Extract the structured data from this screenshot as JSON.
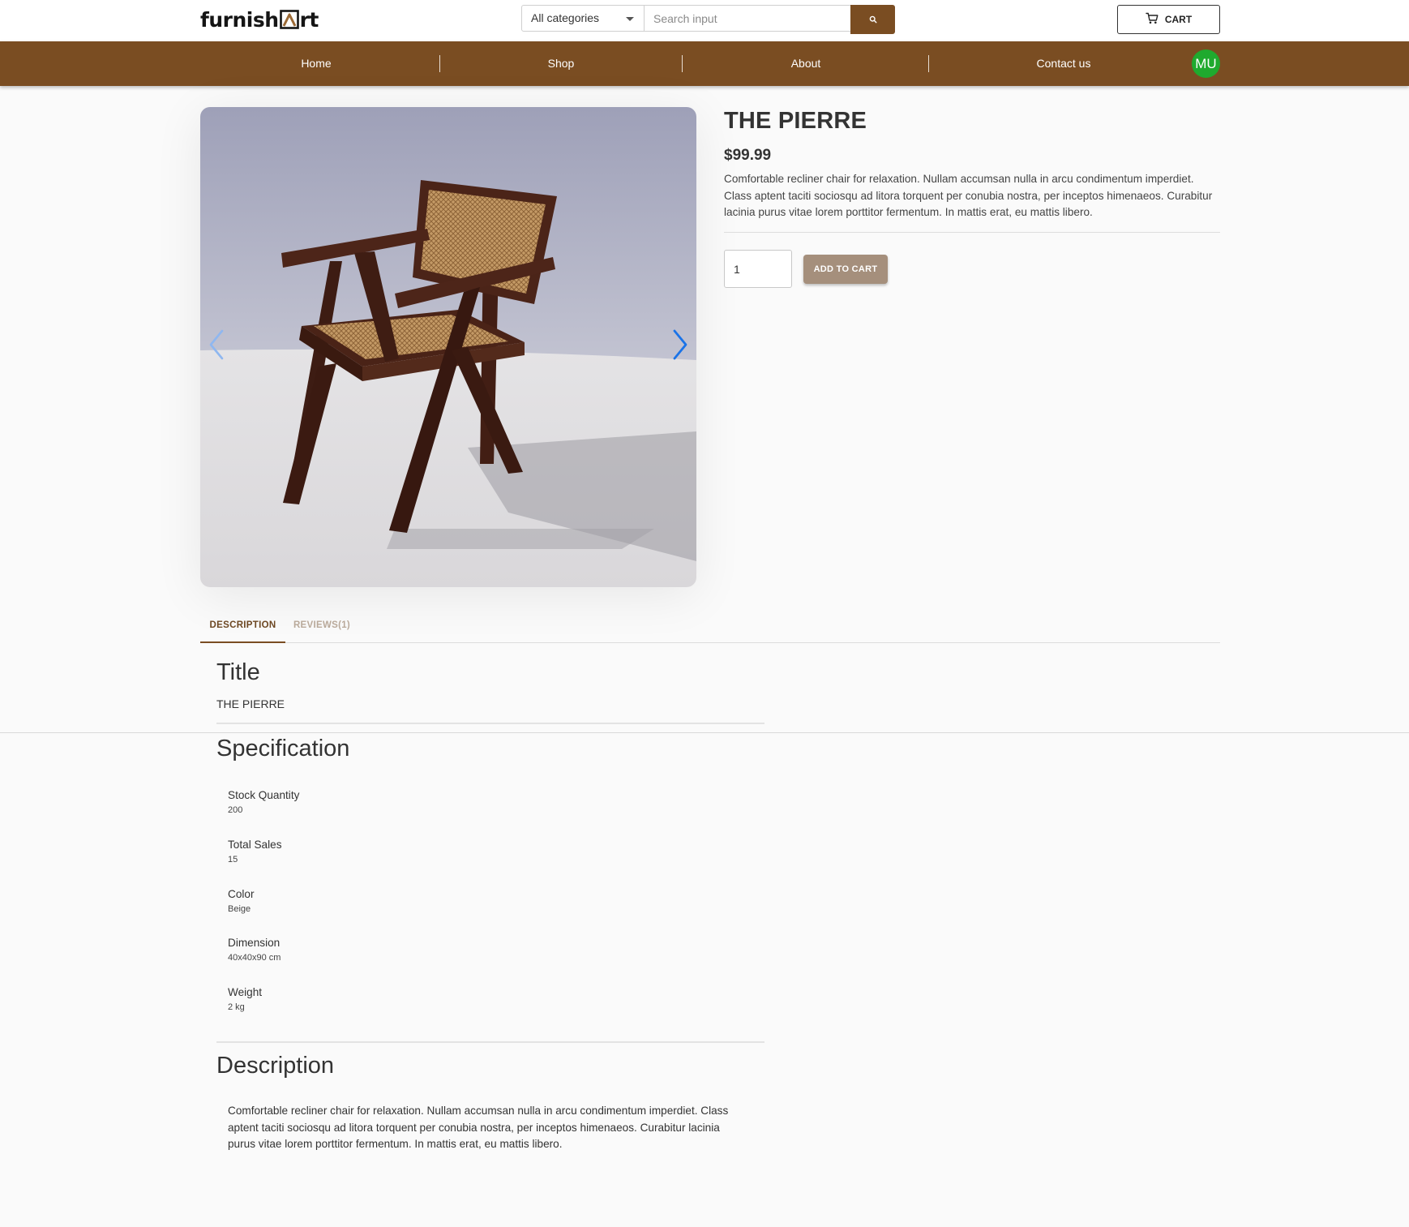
{
  "header": {
    "logo_text_left": "furnish",
    "logo_text_right": "rt",
    "category_select": "All categories",
    "search_placeholder": "Search input",
    "cart_label": "CART"
  },
  "nav": {
    "items": [
      "Home",
      "Shop",
      "About",
      "Contact us"
    ],
    "avatar_initials": "MU"
  },
  "product": {
    "title": "THE PIERRE",
    "price": "$99.99",
    "description": "Comfortable recliner chair for relaxation. Nullam accumsan nulla in arcu condimentum imperdiet. Class aptent taciti sociosqu ad litora torquent per conubia nostra, per inceptos himenaeos. Curabitur lacinia purus vitae lorem porttitor fermentum. In mattis erat, eu mattis libero.",
    "quantity": "1",
    "add_to_cart_label": "ADD TO CART"
  },
  "tabs": [
    "DESCRIPTION",
    "REVIEWS(1)"
  ],
  "details": {
    "title_heading": "Title",
    "title_value": "THE PIERRE",
    "spec_heading": "Specification",
    "specs": [
      {
        "label": "Stock Quantity",
        "value": "200"
      },
      {
        "label": "Total Sales",
        "value": "15"
      },
      {
        "label": "Color",
        "value": "Beige"
      },
      {
        "label": "Dimension",
        "value": "40x40x90 cm"
      },
      {
        "label": "Weight",
        "value": "2 kg"
      }
    ],
    "description_heading": "Description",
    "description_text": "Comfortable recliner chair for relaxation. Nullam accumsan nulla in arcu condimentum imperdiet. Class aptent taciti sociosqu ad litora torquent per conubia nostra, per inceptos himenaeos. Curabitur lacinia purus vitae lorem porttitor fermentum. In mattis erat, eu mattis libero."
  },
  "colors": {
    "brand_brown": "#7a4d22",
    "add_to_cart_bg": "#a58f7c",
    "avatar_green": "#1faa2e",
    "gallery_arrow_blue": "#1a73e8"
  },
  "icons": [
    "logo-mark-icon",
    "chevron-down-icon",
    "search-icon",
    "cart-icon",
    "chevron-left-icon",
    "chevron-right-icon"
  ]
}
